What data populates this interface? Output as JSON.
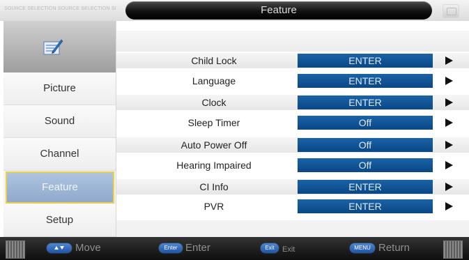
{
  "header": {
    "top_left_text": "SOURCE SELECTION SOURCE SELECTION SEL",
    "title": "Feature"
  },
  "sidebar": {
    "items": [
      {
        "label": "Picture"
      },
      {
        "label": "Sound"
      },
      {
        "label": "Channel"
      },
      {
        "label": "Feature",
        "selected": true
      },
      {
        "label": "Setup"
      }
    ]
  },
  "menu": {
    "rows": [
      {
        "label": "Child Lock",
        "value": "ENTER"
      },
      {
        "label": "Language",
        "value": "ENTER"
      },
      {
        "label": "Clock",
        "value": "ENTER"
      },
      {
        "label": "Sleep Timer",
        "value": "Off"
      },
      {
        "label": "Auto Power Off",
        "value": "Off"
      },
      {
        "label": "Hearing Impaired",
        "value": "Off"
      },
      {
        "label": "CI Info",
        "value": "ENTER"
      },
      {
        "label": "PVR",
        "value": "ENTER"
      }
    ]
  },
  "footer": {
    "move": {
      "label": "Move"
    },
    "enter": {
      "key": "Enter",
      "label": "Enter"
    },
    "exit": {
      "key": "Exit",
      "label": "Exit"
    },
    "return": {
      "key": "MENU",
      "label": "Return"
    }
  },
  "colors": {
    "accent_blue": "#0a4786",
    "selected_bg": "#9fb7d8",
    "selected_border": "#e9d14a"
  },
  "icons": {
    "sidebar_feature": "feature-pen-icon",
    "row_arrow": "arrow-right-icon",
    "move_key": "up-down-icon"
  }
}
